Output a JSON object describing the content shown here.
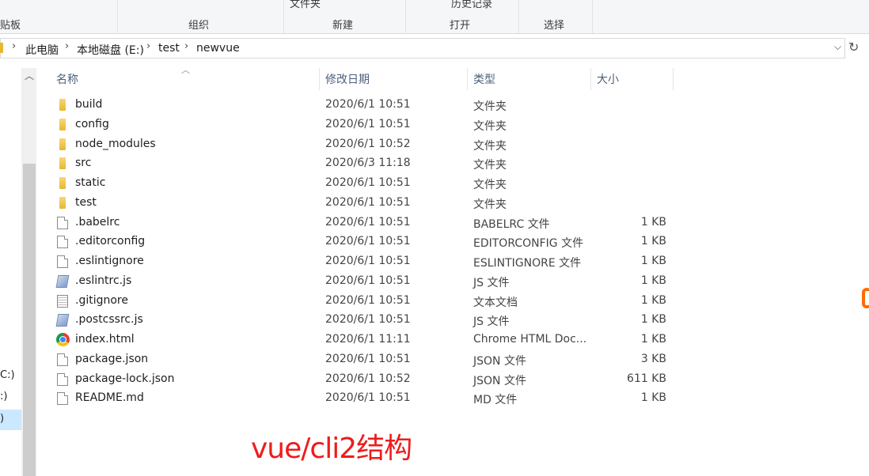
{
  "ribbon": {
    "cut_top": [
      "文件夹",
      "历史记录"
    ],
    "groups": [
      "贴板",
      "组织",
      "新建",
      "打开",
      "选择"
    ]
  },
  "address": {
    "crumbs": [
      "此电脑",
      "本地磁盘 (E:)",
      "test",
      "newvue"
    ]
  },
  "nav": {
    "drives": [
      "C:)",
      ":)",
      ")"
    ]
  },
  "columns": {
    "name": "名称",
    "date": "修改日期",
    "type": "类型",
    "size": "大小"
  },
  "files": [
    {
      "name": "build",
      "date": "2020/6/1 10:51",
      "type": "文件夹",
      "size": "",
      "icon": "folder-icon"
    },
    {
      "name": "config",
      "date": "2020/6/1 10:51",
      "type": "文件夹",
      "size": "",
      "icon": "folder-icon"
    },
    {
      "name": "node_modules",
      "date": "2020/6/1 10:52",
      "type": "文件夹",
      "size": "",
      "icon": "folder-icon"
    },
    {
      "name": "src",
      "date": "2020/6/3 11:18",
      "type": "文件夹",
      "size": "",
      "icon": "folder-icon"
    },
    {
      "name": "static",
      "date": "2020/6/1 10:51",
      "type": "文件夹",
      "size": "",
      "icon": "folder-icon"
    },
    {
      "name": "test",
      "date": "2020/6/1 10:51",
      "type": "文件夹",
      "size": "",
      "icon": "folder-icon"
    },
    {
      "name": ".babelrc",
      "date": "2020/6/1 10:51",
      "type": "BABELRC 文件",
      "size": "1 KB",
      "icon": "file-icon"
    },
    {
      "name": ".editorconfig",
      "date": "2020/6/1 10:51",
      "type": "EDITORCONFIG 文件",
      "size": "1 KB",
      "icon": "file-icon"
    },
    {
      "name": ".eslintignore",
      "date": "2020/6/1 10:51",
      "type": "ESLINTIGNORE 文件",
      "size": "1 KB",
      "icon": "file-icon"
    },
    {
      "name": ".eslintrc.js",
      "date": "2020/6/1 10:51",
      "type": "JS 文件",
      "size": "1 KB",
      "icon": "js-file-icon"
    },
    {
      "name": ".gitignore",
      "date": "2020/6/1 10:51",
      "type": "文本文档",
      "size": "1 KB",
      "icon": "text-file-icon"
    },
    {
      "name": ".postcssrc.js",
      "date": "2020/6/1 10:51",
      "type": "JS 文件",
      "size": "1 KB",
      "icon": "js-file-icon"
    },
    {
      "name": "index.html",
      "date": "2020/6/1 11:11",
      "type": "Chrome HTML Doc...",
      "size": "1 KB",
      "icon": "chrome-icon"
    },
    {
      "name": "package.json",
      "date": "2020/6/1 10:51",
      "type": "JSON 文件",
      "size": "3 KB",
      "icon": "file-icon"
    },
    {
      "name": "package-lock.json",
      "date": "2020/6/1 10:52",
      "type": "JSON 文件",
      "size": "611 KB",
      "icon": "file-icon"
    },
    {
      "name": "README.md",
      "date": "2020/6/1 10:51",
      "type": "MD 文件",
      "size": "1 KB",
      "icon": "file-icon"
    }
  ],
  "annotation": "vue/cli2结构",
  "colors": {
    "annotation": "#ee1c1c",
    "header_text": "#4c607a",
    "folder": "#e8b732"
  }
}
